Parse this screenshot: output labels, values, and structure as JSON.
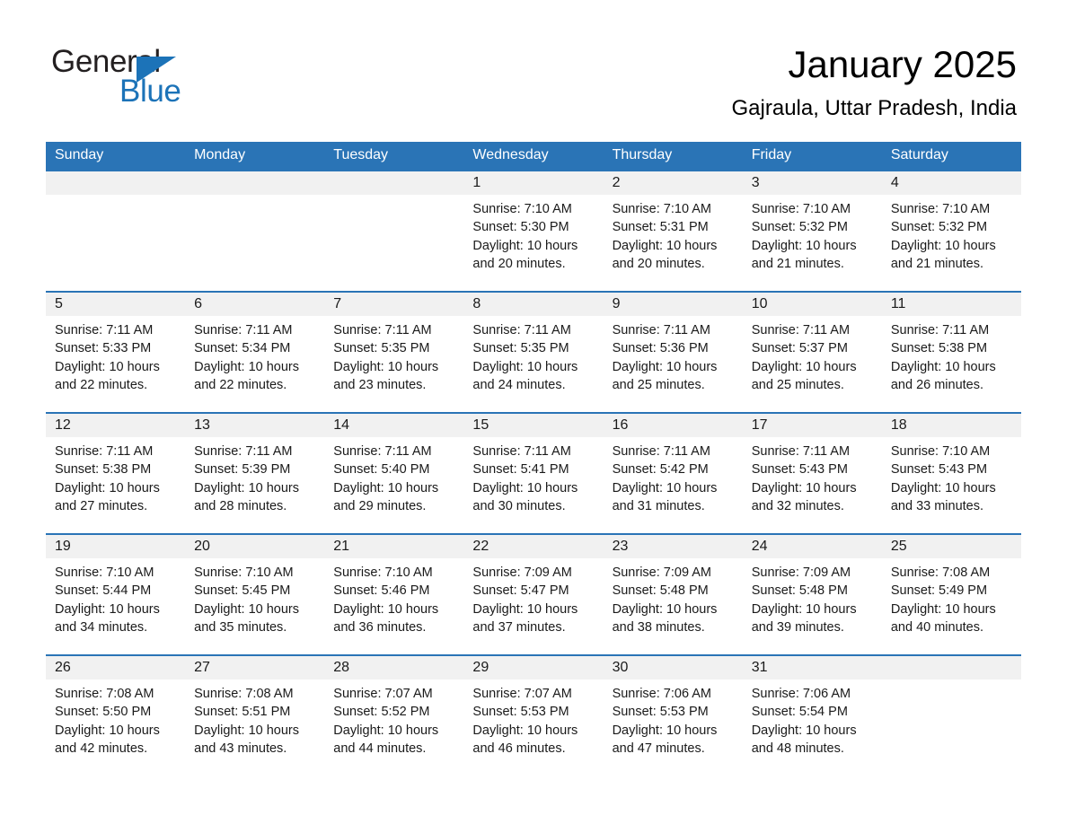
{
  "brand": {
    "line1": "General",
    "line2": "Blue",
    "triangle_color": "#1c73b8",
    "text_color": "#231f20"
  },
  "header": {
    "title": "January 2025",
    "location": "Gajraula, Uttar Pradesh, India"
  },
  "theme": {
    "header_bar_color": "#2a74b6",
    "day_number_bg": "#f1f1f1",
    "row_divider_color": "#2a74b6"
  },
  "weekday_headers": [
    "Sunday",
    "Monday",
    "Tuesday",
    "Wednesday",
    "Thursday",
    "Friday",
    "Saturday"
  ],
  "weeks": [
    [
      {
        "day": "",
        "sunrise": "",
        "sunset": "",
        "daylight1": "",
        "daylight2": ""
      },
      {
        "day": "",
        "sunrise": "",
        "sunset": "",
        "daylight1": "",
        "daylight2": ""
      },
      {
        "day": "",
        "sunrise": "",
        "sunset": "",
        "daylight1": "",
        "daylight2": ""
      },
      {
        "day": "1",
        "sunrise": "Sunrise: 7:10 AM",
        "sunset": "Sunset: 5:30 PM",
        "daylight1": "Daylight: 10 hours",
        "daylight2": "and 20 minutes."
      },
      {
        "day": "2",
        "sunrise": "Sunrise: 7:10 AM",
        "sunset": "Sunset: 5:31 PM",
        "daylight1": "Daylight: 10 hours",
        "daylight2": "and 20 minutes."
      },
      {
        "day": "3",
        "sunrise": "Sunrise: 7:10 AM",
        "sunset": "Sunset: 5:32 PM",
        "daylight1": "Daylight: 10 hours",
        "daylight2": "and 21 minutes."
      },
      {
        "day": "4",
        "sunrise": "Sunrise: 7:10 AM",
        "sunset": "Sunset: 5:32 PM",
        "daylight1": "Daylight: 10 hours",
        "daylight2": "and 21 minutes."
      }
    ],
    [
      {
        "day": "5",
        "sunrise": "Sunrise: 7:11 AM",
        "sunset": "Sunset: 5:33 PM",
        "daylight1": "Daylight: 10 hours",
        "daylight2": "and 22 minutes."
      },
      {
        "day": "6",
        "sunrise": "Sunrise: 7:11 AM",
        "sunset": "Sunset: 5:34 PM",
        "daylight1": "Daylight: 10 hours",
        "daylight2": "and 22 minutes."
      },
      {
        "day": "7",
        "sunrise": "Sunrise: 7:11 AM",
        "sunset": "Sunset: 5:35 PM",
        "daylight1": "Daylight: 10 hours",
        "daylight2": "and 23 minutes."
      },
      {
        "day": "8",
        "sunrise": "Sunrise: 7:11 AM",
        "sunset": "Sunset: 5:35 PM",
        "daylight1": "Daylight: 10 hours",
        "daylight2": "and 24 minutes."
      },
      {
        "day": "9",
        "sunrise": "Sunrise: 7:11 AM",
        "sunset": "Sunset: 5:36 PM",
        "daylight1": "Daylight: 10 hours",
        "daylight2": "and 25 minutes."
      },
      {
        "day": "10",
        "sunrise": "Sunrise: 7:11 AM",
        "sunset": "Sunset: 5:37 PM",
        "daylight1": "Daylight: 10 hours",
        "daylight2": "and 25 minutes."
      },
      {
        "day": "11",
        "sunrise": "Sunrise: 7:11 AM",
        "sunset": "Sunset: 5:38 PM",
        "daylight1": "Daylight: 10 hours",
        "daylight2": "and 26 minutes."
      }
    ],
    [
      {
        "day": "12",
        "sunrise": "Sunrise: 7:11 AM",
        "sunset": "Sunset: 5:38 PM",
        "daylight1": "Daylight: 10 hours",
        "daylight2": "and 27 minutes."
      },
      {
        "day": "13",
        "sunrise": "Sunrise: 7:11 AM",
        "sunset": "Sunset: 5:39 PM",
        "daylight1": "Daylight: 10 hours",
        "daylight2": "and 28 minutes."
      },
      {
        "day": "14",
        "sunrise": "Sunrise: 7:11 AM",
        "sunset": "Sunset: 5:40 PM",
        "daylight1": "Daylight: 10 hours",
        "daylight2": "and 29 minutes."
      },
      {
        "day": "15",
        "sunrise": "Sunrise: 7:11 AM",
        "sunset": "Sunset: 5:41 PM",
        "daylight1": "Daylight: 10 hours",
        "daylight2": "and 30 minutes."
      },
      {
        "day": "16",
        "sunrise": "Sunrise: 7:11 AM",
        "sunset": "Sunset: 5:42 PM",
        "daylight1": "Daylight: 10 hours",
        "daylight2": "and 31 minutes."
      },
      {
        "day": "17",
        "sunrise": "Sunrise: 7:11 AM",
        "sunset": "Sunset: 5:43 PM",
        "daylight1": "Daylight: 10 hours",
        "daylight2": "and 32 minutes."
      },
      {
        "day": "18",
        "sunrise": "Sunrise: 7:10 AM",
        "sunset": "Sunset: 5:43 PM",
        "daylight1": "Daylight: 10 hours",
        "daylight2": "and 33 minutes."
      }
    ],
    [
      {
        "day": "19",
        "sunrise": "Sunrise: 7:10 AM",
        "sunset": "Sunset: 5:44 PM",
        "daylight1": "Daylight: 10 hours",
        "daylight2": "and 34 minutes."
      },
      {
        "day": "20",
        "sunrise": "Sunrise: 7:10 AM",
        "sunset": "Sunset: 5:45 PM",
        "daylight1": "Daylight: 10 hours",
        "daylight2": "and 35 minutes."
      },
      {
        "day": "21",
        "sunrise": "Sunrise: 7:10 AM",
        "sunset": "Sunset: 5:46 PM",
        "daylight1": "Daylight: 10 hours",
        "daylight2": "and 36 minutes."
      },
      {
        "day": "22",
        "sunrise": "Sunrise: 7:09 AM",
        "sunset": "Sunset: 5:47 PM",
        "daylight1": "Daylight: 10 hours",
        "daylight2": "and 37 minutes."
      },
      {
        "day": "23",
        "sunrise": "Sunrise: 7:09 AM",
        "sunset": "Sunset: 5:48 PM",
        "daylight1": "Daylight: 10 hours",
        "daylight2": "and 38 minutes."
      },
      {
        "day": "24",
        "sunrise": "Sunrise: 7:09 AM",
        "sunset": "Sunset: 5:48 PM",
        "daylight1": "Daylight: 10 hours",
        "daylight2": "and 39 minutes."
      },
      {
        "day": "25",
        "sunrise": "Sunrise: 7:08 AM",
        "sunset": "Sunset: 5:49 PM",
        "daylight1": "Daylight: 10 hours",
        "daylight2": "and 40 minutes."
      }
    ],
    [
      {
        "day": "26",
        "sunrise": "Sunrise: 7:08 AM",
        "sunset": "Sunset: 5:50 PM",
        "daylight1": "Daylight: 10 hours",
        "daylight2": "and 42 minutes."
      },
      {
        "day": "27",
        "sunrise": "Sunrise: 7:08 AM",
        "sunset": "Sunset: 5:51 PM",
        "daylight1": "Daylight: 10 hours",
        "daylight2": "and 43 minutes."
      },
      {
        "day": "28",
        "sunrise": "Sunrise: 7:07 AM",
        "sunset": "Sunset: 5:52 PM",
        "daylight1": "Daylight: 10 hours",
        "daylight2": "and 44 minutes."
      },
      {
        "day": "29",
        "sunrise": "Sunrise: 7:07 AM",
        "sunset": "Sunset: 5:53 PM",
        "daylight1": "Daylight: 10 hours",
        "daylight2": "and 46 minutes."
      },
      {
        "day": "30",
        "sunrise": "Sunrise: 7:06 AM",
        "sunset": "Sunset: 5:53 PM",
        "daylight1": "Daylight: 10 hours",
        "daylight2": "and 47 minutes."
      },
      {
        "day": "31",
        "sunrise": "Sunrise: 7:06 AM",
        "sunset": "Sunset: 5:54 PM",
        "daylight1": "Daylight: 10 hours",
        "daylight2": "and 48 minutes."
      },
      {
        "day": "",
        "sunrise": "",
        "sunset": "",
        "daylight1": "",
        "daylight2": ""
      }
    ]
  ]
}
